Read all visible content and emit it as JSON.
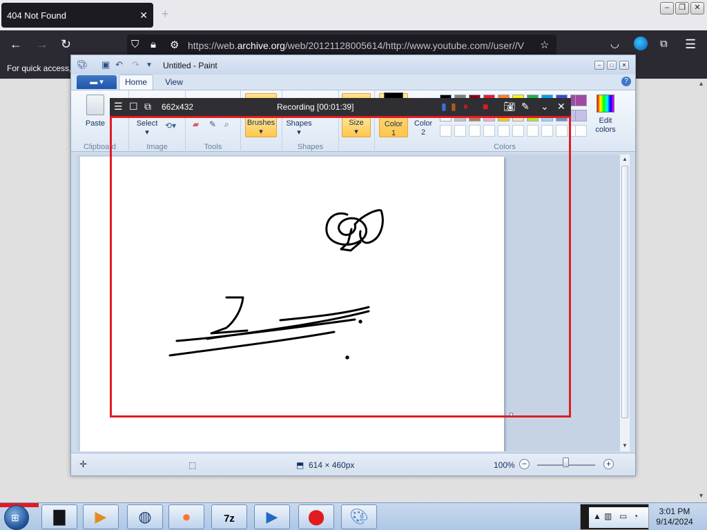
{
  "browser": {
    "tab_title": "404 Not Found",
    "tab_close": "✕",
    "new_tab": "+",
    "url_host": "https://web.",
    "url_domain": "archive.org",
    "url_rest": "/web/20121128005614/http://www.youtube.com//user//V",
    "bookmarks_text": "For quick access,",
    "window_buttons": {
      "minimize": "–",
      "restore": "❐",
      "close": "✕"
    }
  },
  "paint": {
    "title": "Untitled - Paint",
    "tabs": {
      "home": "Home",
      "view": "View"
    },
    "groups": {
      "clipboard": "Clipboard",
      "image": "Image",
      "tools": "Tools",
      "shapes": "Shapes",
      "colors": "Colors"
    },
    "buttons": {
      "paste": "Paste",
      "select": "Select",
      "brushes": "Brushes",
      "shapes": "Shapes",
      "size": "Size",
      "color1_a": "Color",
      "color1_b": "1",
      "color2_a": "Color",
      "color2_b": "2",
      "edit_colors_a": "Edit",
      "edit_colors_b": "colors"
    },
    "palette": [
      "#000000",
      "#7f7f7f",
      "#880015",
      "#ed1c24",
      "#ff7f27",
      "#fff200",
      "#22b14c",
      "#00a2e8",
      "#3f48cc",
      "#a349a4"
    ],
    "palette_row2": [
      "#ffffff",
      "#c3c3c3",
      "#b97a57",
      "#ffaec9",
      "#ffc90e",
      "#efe4b0",
      "#b5e61d",
      "#99d9ea",
      "#7092be",
      "#c8bfe7"
    ],
    "status": {
      "canvas_size": "614 × 460px",
      "zoom": "100%"
    }
  },
  "recorder": {
    "dimensions": "662x432",
    "recording": "Recording [00:01:39]",
    "frame_color": "#e11b22"
  },
  "taskbar": {
    "seven_zip": "7z",
    "time": "3:01 PM",
    "date": "9/14/2024"
  }
}
